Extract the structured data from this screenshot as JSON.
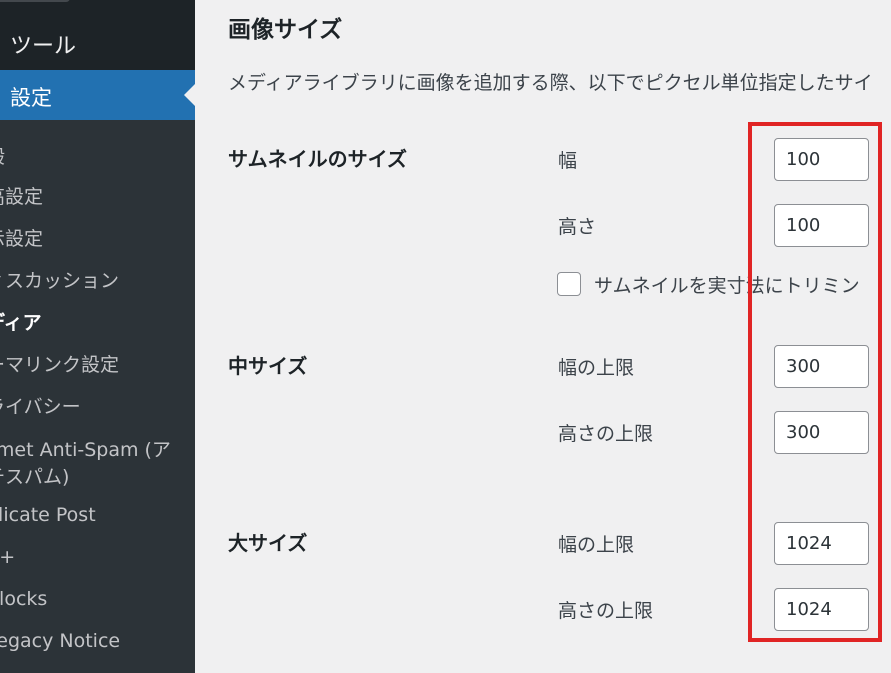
{
  "sidebar": {
    "tools_label": "ツール",
    "settings_label": "設定",
    "submenu": [
      {
        "label": "般"
      },
      {
        "label": "高設定"
      },
      {
        "label": "示設定"
      },
      {
        "label": "ィスカッション"
      },
      {
        "label": "ディア",
        "current": true
      },
      {
        "label": "ーマリンク設定"
      },
      {
        "label": "ライバシー"
      },
      {
        "label": "smet Anti-Spam (ア"
      },
      {
        "label": "チスパム)"
      },
      {
        "label": "plicate Post"
      },
      {
        "label": "C+"
      },
      {
        "label": "Blocks"
      },
      {
        "label": "Legacy Notice"
      }
    ]
  },
  "content": {
    "heading": "画像サイズ",
    "description": "メディアライブラリに画像を追加する際、以下でピクセル単位指定したサイ",
    "thumbnail": {
      "title": "サムネイルのサイズ",
      "width_label": "幅",
      "width_value": "100",
      "height_label": "高さ",
      "height_value": "100",
      "crop_label": "サムネイルを実寸法にトリミン"
    },
    "medium": {
      "title": "中サイズ",
      "width_label": "幅の上限",
      "width_value": "300",
      "height_label": "高さの上限",
      "height_value": "300"
    },
    "large": {
      "title": "大サイズ",
      "width_label": "幅の上限",
      "width_value": "1024",
      "height_label": "高さの上限",
      "height_value": "1024"
    }
  },
  "colors": {
    "sidebar_bg": "#2c3338",
    "sidebar_top_bg": "#1d2327",
    "active_menu": "#2271b1",
    "page_bg": "#f0f0f1",
    "highlight": "#e02424"
  }
}
